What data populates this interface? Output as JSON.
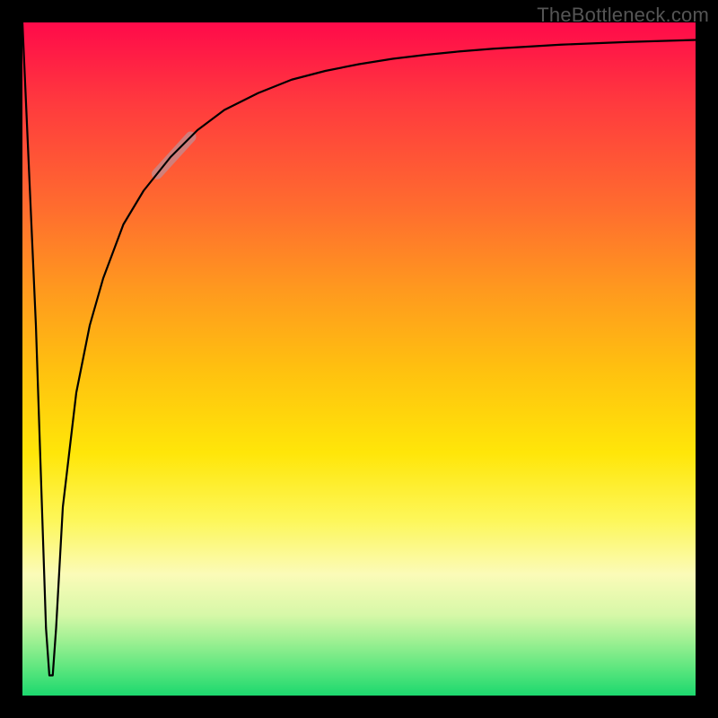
{
  "watermark": "TheBottleneck.com",
  "chart_data": {
    "type": "line",
    "title": "",
    "xlabel": "",
    "ylabel": "",
    "xlim": [
      0,
      100
    ],
    "ylim": [
      0,
      100
    ],
    "grid": false,
    "legend": false,
    "annotations": [
      {
        "kind": "highlight-segment",
        "x_range": [
          20,
          25
        ],
        "note": "pale thick overlay on rising branch"
      }
    ],
    "series": [
      {
        "name": "curve",
        "x": [
          0,
          2,
          3.5,
          4,
          4.5,
          5,
          6,
          8,
          10,
          12,
          15,
          18,
          22,
          26,
          30,
          35,
          40,
          45,
          50,
          55,
          60,
          65,
          70,
          75,
          80,
          85,
          90,
          95,
          100
        ],
        "y": [
          100,
          55,
          10,
          3,
          3,
          10,
          28,
          45,
          55,
          62,
          70,
          75,
          80,
          84,
          87,
          89.5,
          91.5,
          92.8,
          93.8,
          94.6,
          95.2,
          95.7,
          96.1,
          96.4,
          96.7,
          96.9,
          97.1,
          97.25,
          97.4
        ]
      }
    ]
  }
}
